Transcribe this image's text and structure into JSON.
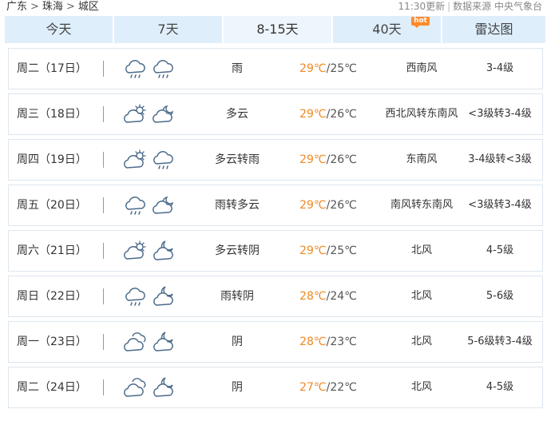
{
  "breadcrumb": {
    "province": "广东",
    "city": "珠海",
    "district": "城区",
    "sep": ">"
  },
  "meta": {
    "update_time": "11:30更新",
    "source_label": "数据来源 中央气象台"
  },
  "tabs": [
    {
      "label": "今天",
      "active": false
    },
    {
      "label": "7天",
      "active": false
    },
    {
      "label": "8-15天",
      "active": true
    },
    {
      "label": "40天",
      "active": false,
      "badge": "hot"
    },
    {
      "label": "雷达图",
      "active": false
    }
  ],
  "colors": {
    "tab_bg": "#dfeefb",
    "tab_active_bg": "#eef6fd",
    "high_temp": "#f08a24",
    "hot_badge": "#ff8a2a",
    "icon_stroke": "#4a6a8a"
  },
  "days": [
    {
      "date": "周二（17日）",
      "icon_day": "rain-icon",
      "icon_night": "rain-icon",
      "desc": "雨",
      "high": "29℃",
      "low": "25℃",
      "wind": "西南风",
      "level": "3-4级"
    },
    {
      "date": "周三（18日）",
      "icon_day": "partly-cloudy-icon",
      "icon_night": "cloudy-night-icon",
      "desc": "多云",
      "high": "29℃",
      "low": "26℃",
      "wind": "西北风转东南风",
      "level": "<3级转3-4级"
    },
    {
      "date": "周四（19日）",
      "icon_day": "partly-cloudy-icon",
      "icon_night": "rain-icon",
      "desc": "多云转雨",
      "high": "29℃",
      "low": "26℃",
      "wind": "东南风",
      "level": "3-4级转<3级"
    },
    {
      "date": "周五（20日）",
      "icon_day": "rain-icon",
      "icon_night": "cloudy-night-icon",
      "desc": "雨转多云",
      "high": "29℃",
      "low": "26℃",
      "wind": "南风转东南风",
      "level": "<3级转3-4级"
    },
    {
      "date": "周六（21日）",
      "icon_day": "partly-cloudy-icon",
      "icon_night": "overcast-night-icon",
      "desc": "多云转阴",
      "high": "29℃",
      "low": "25℃",
      "wind": "北风",
      "level": "4-5级"
    },
    {
      "date": "周日（22日）",
      "icon_day": "rain-icon",
      "icon_night": "overcast-night-icon",
      "desc": "雨转阴",
      "high": "28℃",
      "low": "24℃",
      "wind": "北风",
      "level": "5-6级"
    },
    {
      "date": "周一（23日）",
      "icon_day": "overcast-icon",
      "icon_night": "overcast-night-icon",
      "desc": "阴",
      "high": "28℃",
      "low": "23℃",
      "wind": "北风",
      "level": "5-6级转3-4级"
    },
    {
      "date": "周二（24日）",
      "icon_day": "overcast-icon",
      "icon_night": "overcast-night-icon",
      "desc": "阴",
      "high": "27℃",
      "low": "22℃",
      "wind": "北风",
      "level": "4-5级"
    }
  ]
}
